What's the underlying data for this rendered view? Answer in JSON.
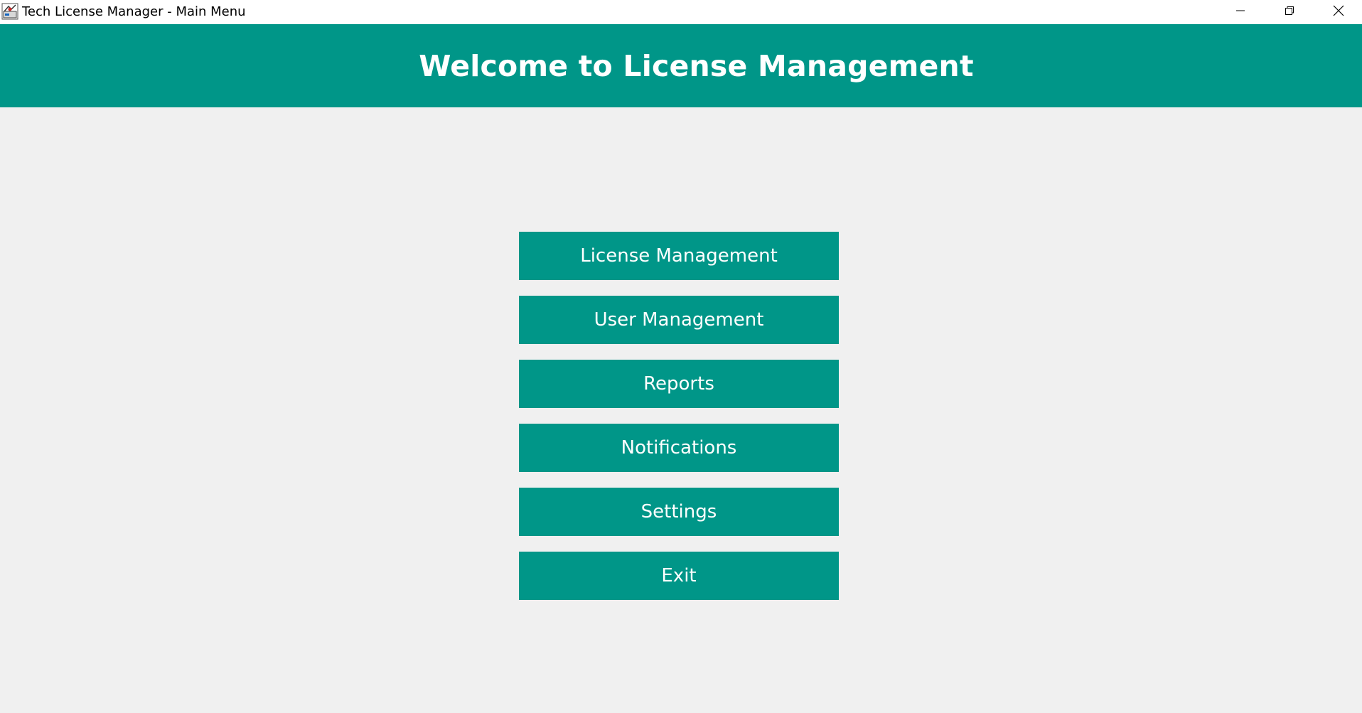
{
  "window": {
    "title": "Tech License Manager - Main Menu",
    "icon": "java-app-icon",
    "controls": {
      "minimize_icon": "minimize-icon",
      "maximize_icon": "restore-icon",
      "close_icon": "close-icon"
    }
  },
  "header": {
    "title": "Welcome to License Management",
    "background_color": "#009688",
    "text_color": "#ffffff"
  },
  "menu": {
    "buttons": [
      {
        "label": "License Management"
      },
      {
        "label": "User Management"
      },
      {
        "label": "Reports"
      },
      {
        "label": "Notifications"
      },
      {
        "label": "Settings"
      },
      {
        "label": "Exit"
      }
    ],
    "button_color": "#009688",
    "button_text_color": "#ffffff"
  },
  "colors": {
    "background": "#f0f0f0",
    "accent": "#009688"
  }
}
